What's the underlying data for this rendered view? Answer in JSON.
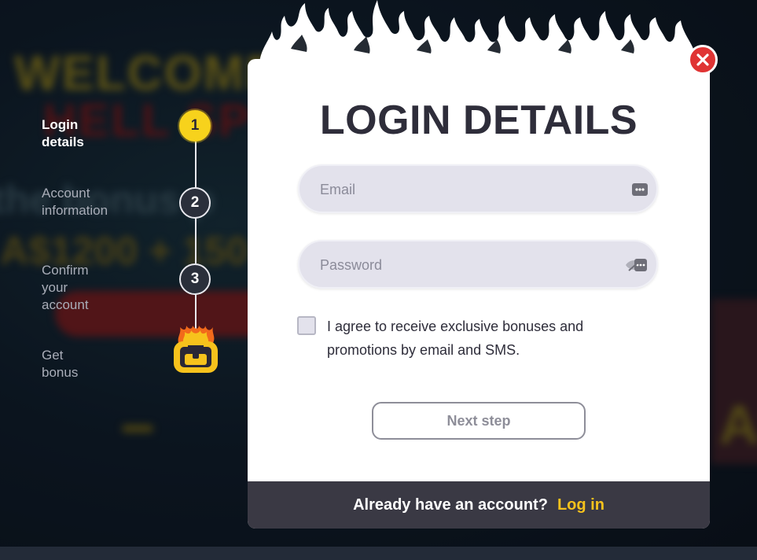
{
  "background": {
    "welcome": "WELCOME",
    "hell": "HELL SPIN",
    "line3": "the bonus p",
    "line4": "A$1200 + 150",
    "right_text": "AS"
  },
  "stepper": {
    "steps": [
      {
        "number": "1",
        "label": "Login details",
        "active": true
      },
      {
        "number": "2",
        "label_line1": "Account",
        "label_line2": "information"
      },
      {
        "number": "3",
        "label_line1": "Confirm your",
        "label_line2": "account"
      },
      {
        "label": "Get bonus",
        "icon": "treasure-chest-icon"
      }
    ]
  },
  "modal": {
    "title": "LOGIN DETAILS",
    "email_placeholder": "Email",
    "email_icon": "password-dots-icon",
    "password_placeholder": "Password",
    "password_icon": "eye-hidden-icon",
    "consent_line1": "I agree to receive exclusive bonuses and",
    "consent_line2": "promotions by email and SMS.",
    "next_label": "Next step",
    "footer_text": "Already have an account?",
    "footer_link": "Log in",
    "close_icon": "close-icon"
  },
  "colors": {
    "accent_yellow": "#f7d21c",
    "close_red": "#e03434",
    "footer_bg": "#3a3944",
    "title_dark": "#2e2d3a"
  }
}
